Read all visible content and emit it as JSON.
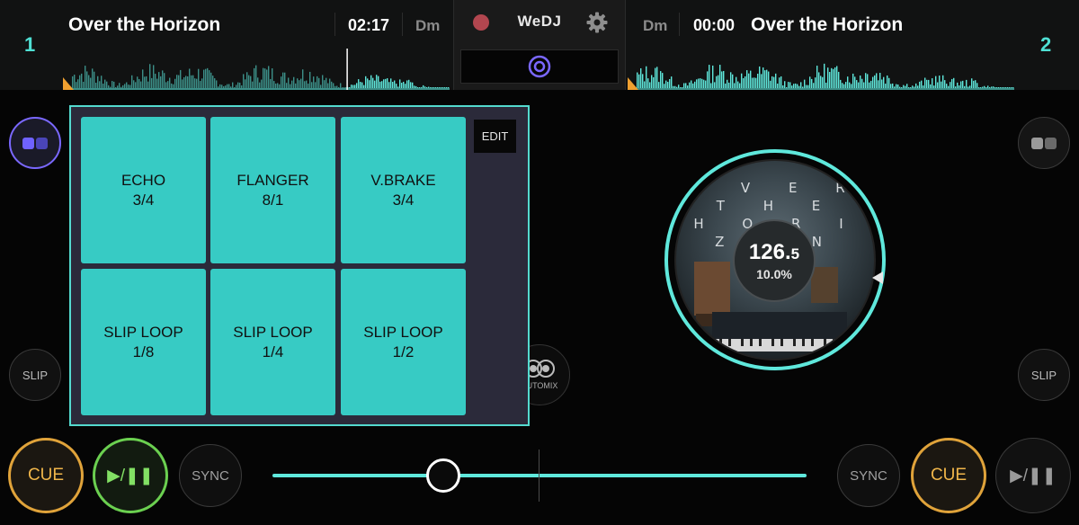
{
  "deck_a": {
    "number": "1",
    "title": "Over the Horizon",
    "time": "02:17",
    "key": "Dm",
    "progress": 0.73,
    "slip_label": "SLIP",
    "cue_label": "CUE",
    "play_label": "▶/❚❚",
    "sync_label": "SYNC"
  },
  "deck_b": {
    "number": "2",
    "title": "Over the Horizon",
    "time": "00:00",
    "key": "Dm",
    "progress": 0.0,
    "slip_label": "SLIP",
    "cue_label": "CUE",
    "play_label": "▶/❚❚",
    "sync_label": "SYNC",
    "bpm_whole": "126.",
    "bpm_decimal": "5",
    "pitch": "10.0%",
    "cover_text": [
      "O V E R",
      "T H E",
      "H O R I Z O N"
    ]
  },
  "center": {
    "logo": "WeDJ",
    "automix_label": "AUTOMIX"
  },
  "fx_pads": {
    "edit_label": "EDIT",
    "pads": [
      {
        "name": "ECHO",
        "value": "3/4"
      },
      {
        "name": "FLANGER",
        "value": "8/1"
      },
      {
        "name": "V.BRAKE",
        "value": "3/4"
      },
      {
        "name": "SLIP LOOP",
        "value": "1/8"
      },
      {
        "name": "SLIP LOOP",
        "value": "1/4"
      },
      {
        "name": "SLIP LOOP",
        "value": "1/2"
      }
    ]
  },
  "crossfader": {
    "position": 0.32
  },
  "colors": {
    "accent": "#5fe8dc",
    "pad": "#37cbc4",
    "cue": "#e0a33a",
    "play_active": "#6bd050",
    "record": "#b2464f",
    "fx_active": "#7a68ff"
  },
  "icons": {
    "record": "record-icon",
    "settings": "gear-icon",
    "fx_toggle": "fx-squares-icon",
    "automix": "automix-icon",
    "mini": "target-icon"
  }
}
